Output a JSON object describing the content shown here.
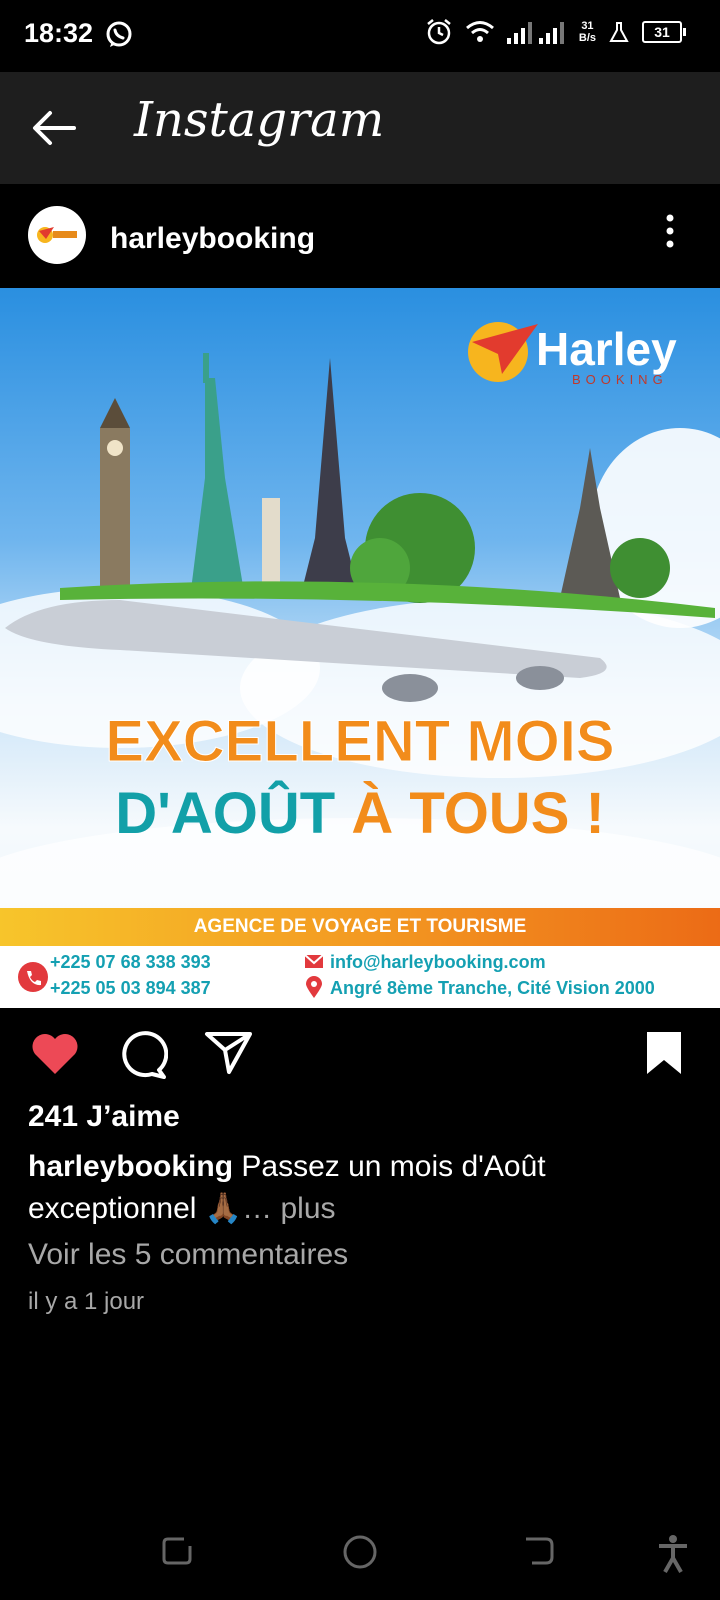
{
  "status_bar": {
    "time": "18:32",
    "net_speed_value": "31",
    "net_speed_unit": "B/s",
    "battery": "31"
  },
  "app_bar": {
    "title": "Instagram"
  },
  "post": {
    "username": "harleybooking",
    "image": {
      "brand_name": "Harley",
      "brand_sub": "BOOKING",
      "headline_line1": "EXCELLENT MOIS",
      "headline_line2_part1": "D'AOÛT",
      "headline_line2_part2": "À TOUS !",
      "banner": "AGENCE DE VOYAGE ET TOURISME",
      "phone1": "+225 07 68 338 393",
      "phone2": "+225 05 03 894 387",
      "email": "info@harleybooking.com",
      "address": "Angré 8ème Tranche, Cité Vision 2000"
    },
    "likes": "241 J’aime",
    "caption_user": "harleybooking",
    "caption_text": "Passez un mois d'Août exceptionnel 🙏🏾",
    "caption_more": "… plus",
    "comments_link": "Voir les 5 commentaires",
    "timestamp": "il y a 1 jour"
  },
  "colors": {
    "like": "#ed4956",
    "brand_orange": "#f28c1b",
    "brand_teal": "#12a0a8"
  },
  "icons": [
    "whatsapp-icon",
    "alarm-icon",
    "wifi-icon",
    "signal-icon",
    "battery-icon",
    "back-arrow-icon",
    "more-vert-icon",
    "heart-icon",
    "comment-icon",
    "share-icon",
    "bookmark-icon",
    "recents-icon",
    "home-icon",
    "back-gesture-icon",
    "accessibility-icon"
  ]
}
